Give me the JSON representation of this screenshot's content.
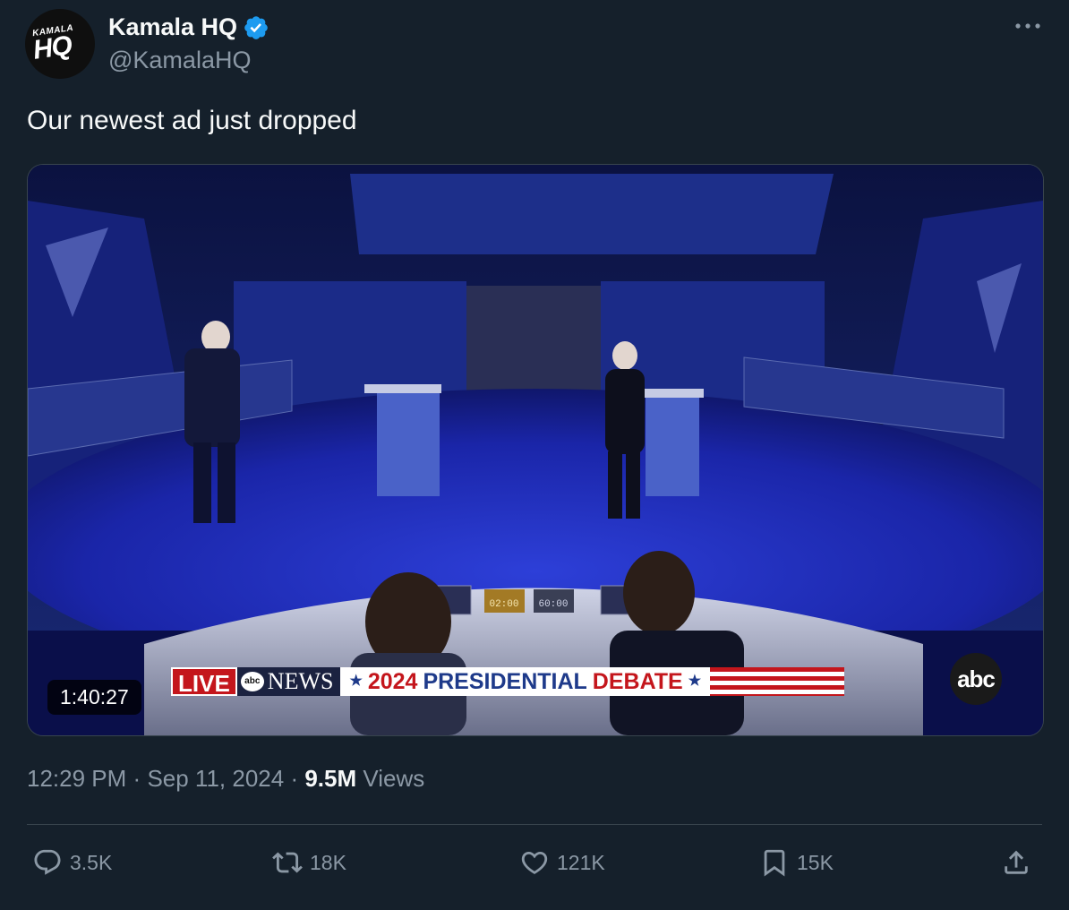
{
  "tweet": {
    "display_name": "Kamala HQ",
    "handle": "@KamalaHQ",
    "avatar_text_small": "KAMALA",
    "avatar_text_big": "HQ",
    "text": "Our newest ad just dropped",
    "time": "12:29 PM",
    "date": "Sep 11, 2024",
    "views_count": "9.5M",
    "views_label": "Views",
    "separator": "·"
  },
  "media": {
    "duration": "1:40:27",
    "live_label": "LIVE",
    "network_label": "NEWS",
    "network_dot": "abc",
    "banner_year": "2024",
    "banner_text_1": "PRESIDENTIAL",
    "banner_text_2": "DEBATE",
    "corner_logo": "abc",
    "clock_1": "02:00",
    "clock_2": "60:00"
  },
  "actions": {
    "replies": "3.5K",
    "reposts": "18K",
    "likes": "121K",
    "bookmarks": "15K"
  },
  "colors": {
    "background": "#15202b",
    "muted": "#8b98a5",
    "verified": "#1d9bf0",
    "live_red": "#c4161c"
  }
}
